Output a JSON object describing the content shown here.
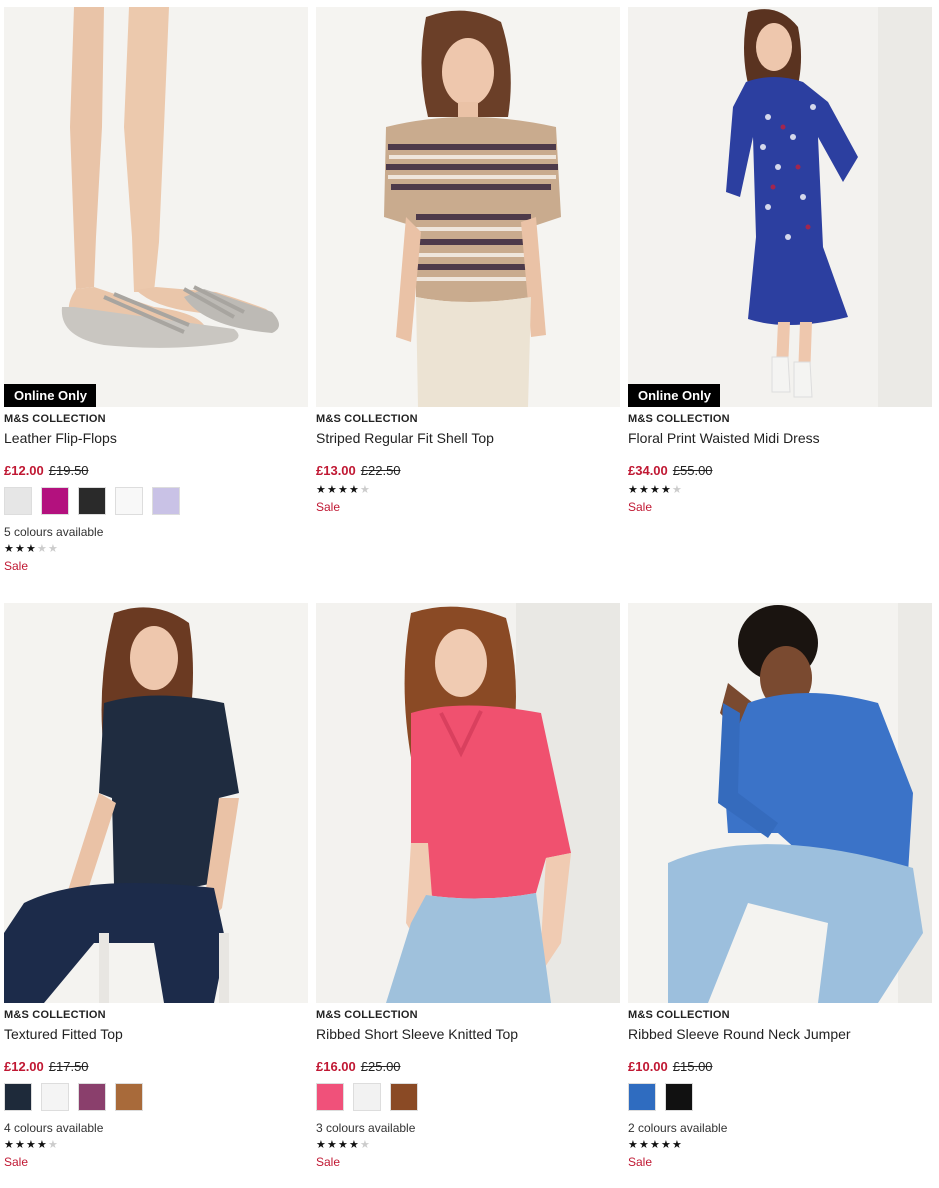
{
  "products": [
    {
      "brand": "M&S COLLECTION",
      "name": "Leather Flip-Flops",
      "badge": "Online Only",
      "price_now": "£12.00",
      "price_was": "£19.50",
      "swatches": [
        "#e6e6e6",
        "#b3117e",
        "#2a2a2a",
        "#f8f8f8",
        "#c9c2e6"
      ],
      "colours_text": "5 colours available",
      "rating": 3,
      "sale": "Sale",
      "image": "flip-flops"
    },
    {
      "brand": "M&S COLLECTION",
      "name": "Striped Regular Fit Shell Top",
      "badge": "",
      "price_now": "£13.00",
      "price_was": "£22.50",
      "swatches": [],
      "colours_text": "",
      "rating": 3.5,
      "sale": "Sale",
      "image": "striped-top"
    },
    {
      "brand": "M&S COLLECTION",
      "name": "Floral Print Waisted Midi Dress",
      "badge": "Online Only",
      "price_now": "£34.00",
      "price_was": "£55.00",
      "swatches": [],
      "colours_text": "",
      "rating": 4,
      "sale": "Sale",
      "image": "floral-dress"
    },
    {
      "brand": "M&S COLLECTION",
      "name": "Textured Fitted Top",
      "badge": "",
      "price_now": "£12.00",
      "price_was": "£17.50",
      "swatches": [
        "#1e2a3a",
        "#f4f4f4",
        "#8a3f6c",
        "#a86a3a"
      ],
      "colours_text": "4 colours available",
      "rating": 4,
      "sale": "Sale",
      "image": "navy-top"
    },
    {
      "brand": "M&S COLLECTION",
      "name": "Ribbed Short Sleeve Knitted Top",
      "badge": "",
      "price_now": "£16.00",
      "price_was": "£25.00",
      "swatches": [
        "#f0517a",
        "#f2f2f2",
        "#8a4a25"
      ],
      "colours_text": "3 colours available",
      "rating": 4,
      "sale": "Sale",
      "image": "pink-top"
    },
    {
      "brand": "M&S COLLECTION",
      "name": "Ribbed Sleeve Round Neck Jumper",
      "badge": "",
      "price_now": "£10.00",
      "price_was": "£15.00",
      "swatches": [
        "#2f6cc0",
        "#111111"
      ],
      "colours_text": "2 colours available",
      "rating": 4.5,
      "sale": "Sale",
      "image": "blue-jumper"
    }
  ],
  "colors": {
    "sale": "#c01833",
    "badge_bg": "#000000"
  }
}
